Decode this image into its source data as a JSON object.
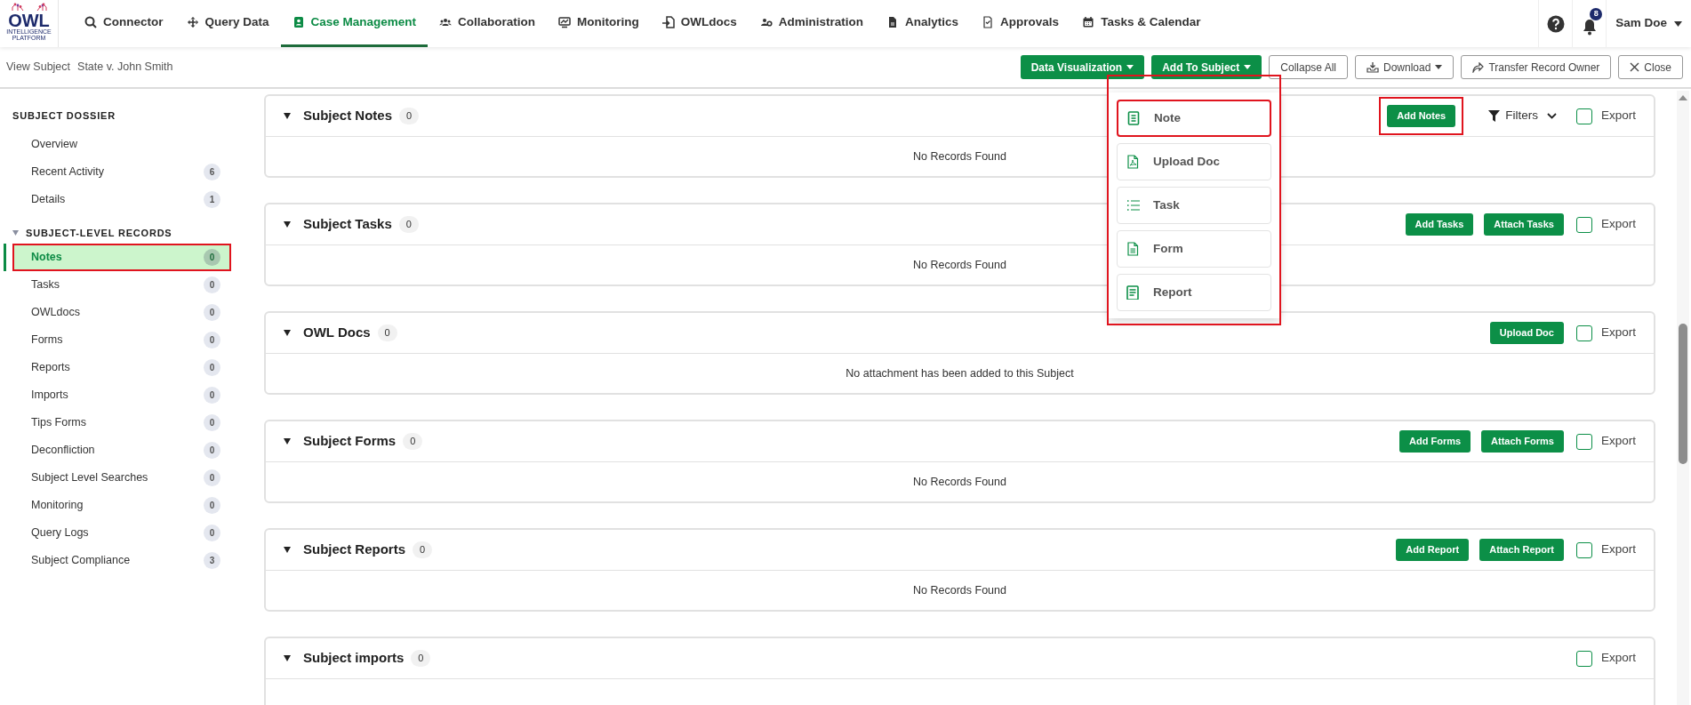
{
  "logo": {
    "text": "OWL",
    "subtext": "INTELLIGENCE PLATFORM"
  },
  "nav": [
    {
      "label": "Connector",
      "selected": false
    },
    {
      "label": "Query Data",
      "selected": false
    },
    {
      "label": "Case Management",
      "selected": true
    },
    {
      "label": "Collaboration",
      "selected": false
    },
    {
      "label": "Monitoring",
      "selected": false
    },
    {
      "label": "OWLdocs",
      "selected": false
    },
    {
      "label": "Administration",
      "selected": false
    },
    {
      "label": "Analytics",
      "selected": false
    },
    {
      "label": "Approvals",
      "selected": false
    },
    {
      "label": "Tasks & Calendar",
      "selected": false
    }
  ],
  "user": {
    "notification_count": "8",
    "name": "Sam Doe"
  },
  "breadcrumb": {
    "label": "View Subject",
    "value": "State v. John Smith"
  },
  "toolbar": [
    {
      "label": "Data Visualization",
      "kind": "primary-dropdown"
    },
    {
      "label": "Add To Subject",
      "kind": "primary-dropdown"
    },
    {
      "label": "Collapse All",
      "kind": "outline"
    },
    {
      "label": "Download",
      "kind": "download"
    },
    {
      "label": "Transfer Record Owner",
      "kind": "transfer"
    },
    {
      "label": "Close",
      "kind": "close"
    }
  ],
  "menu": {
    "highlighted": true,
    "items": [
      {
        "label": "Note",
        "highlighted": true
      },
      {
        "label": "Upload Doc",
        "highlighted": false
      },
      {
        "label": "Task",
        "highlighted": false
      },
      {
        "label": "Form",
        "highlighted": false
      },
      {
        "label": "Report",
        "highlighted": false
      }
    ]
  },
  "sidebar": [
    {
      "title": "SUBJECT DOSSIER",
      "kind": "plain",
      "items": [
        {
          "label": "Overview",
          "selected": false,
          "highlighted": false
        },
        {
          "label": "Recent Activity",
          "count": "6",
          "selected": false,
          "highlighted": false
        },
        {
          "label": "Details",
          "count": "1",
          "selected": false,
          "highlighted": false
        }
      ]
    },
    {
      "title": "SUBJECT-LEVEL RECORDS",
      "kind": "collapsible",
      "expanded": true,
      "items": [
        {
          "label": "Notes",
          "count": "0",
          "selected": true,
          "highlighted": true
        },
        {
          "label": "Tasks",
          "count": "0",
          "selected": false,
          "highlighted": false
        },
        {
          "label": "OWLdocs",
          "count": "0",
          "selected": false,
          "highlighted": false
        },
        {
          "label": "Forms",
          "count": "0",
          "selected": false,
          "highlighted": false
        },
        {
          "label": "Reports",
          "count": "0",
          "selected": false,
          "highlighted": false
        },
        {
          "label": "Imports",
          "count": "0",
          "selected": false,
          "highlighted": false
        },
        {
          "label": "Tips Forms",
          "count": "0",
          "selected": false,
          "highlighted": false
        },
        {
          "label": "Deconfliction",
          "count": "0",
          "selected": false,
          "highlighted": false
        },
        {
          "label": "Subject Level Searches",
          "count": "0",
          "selected": false,
          "highlighted": false
        },
        {
          "label": "Monitoring",
          "count": "0",
          "selected": false,
          "highlighted": false
        },
        {
          "label": "Query Logs",
          "count": "0",
          "selected": false,
          "highlighted": false
        },
        {
          "label": "Subject Compliance",
          "count": "3",
          "selected": false,
          "highlighted": false
        }
      ]
    }
  ],
  "sections": [
    {
      "title": "Subject Notes",
      "count": "0",
      "expanded": true,
      "actions": [
        {
          "label": "Add Notes",
          "kind": "button",
          "highlighted": true
        },
        {
          "label": "Filters",
          "kind": "filters",
          "highlighted": false
        }
      ],
      "export": {
        "label": "Export",
        "checked": false
      },
      "message": "No Records Found"
    },
    {
      "title": "Subject Tasks",
      "count": "0",
      "expanded": true,
      "actions": [
        {
          "label": "Add Tasks",
          "kind": "button",
          "highlighted": false
        },
        {
          "label": "Attach Tasks",
          "kind": "button",
          "highlighted": false
        }
      ],
      "export": {
        "label": "Export",
        "checked": false
      },
      "message": "No Records Found"
    },
    {
      "title": "OWL Docs",
      "count": "0",
      "expanded": true,
      "actions": [
        {
          "label": "Upload Doc",
          "kind": "button",
          "highlighted": false
        }
      ],
      "export": {
        "label": "Export",
        "checked": false
      },
      "message": "No attachment has been added to this Subject"
    },
    {
      "title": "Subject Forms",
      "count": "0",
      "expanded": true,
      "actions": [
        {
          "label": "Add Forms",
          "kind": "button",
          "highlighted": false
        },
        {
          "label": "Attach Forms",
          "kind": "button",
          "highlighted": false
        }
      ],
      "export": {
        "label": "Export",
        "checked": false
      },
      "message": "No Records Found"
    },
    {
      "title": "Subject Reports",
      "count": "0",
      "expanded": true,
      "actions": [
        {
          "label": "Add Report",
          "kind": "button",
          "highlighted": false
        },
        {
          "label": "Attach Report",
          "kind": "button",
          "highlighted": false
        }
      ],
      "export": {
        "label": "Export",
        "checked": false
      },
      "message": "No Records Found"
    },
    {
      "title": "Subject imports",
      "count": "0",
      "expanded": true,
      "export": {
        "label": "Export",
        "checked": false
      }
    }
  ]
}
